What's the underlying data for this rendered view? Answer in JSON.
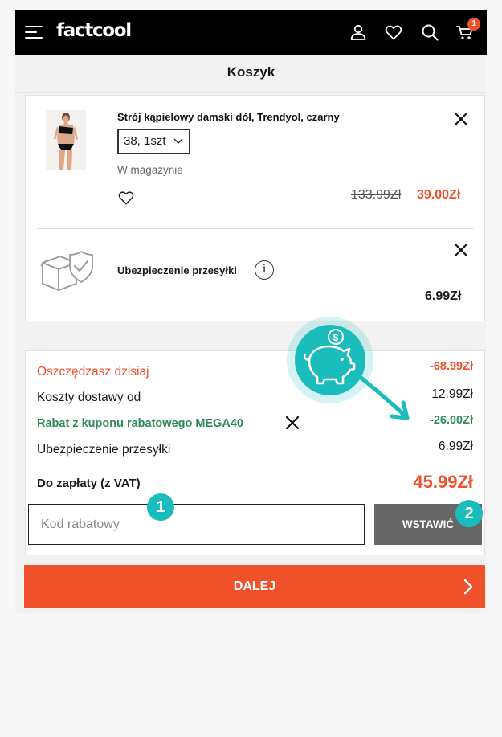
{
  "header": {
    "logo_text": "factcool",
    "cart_count": "1",
    "icons": [
      "menu-icon",
      "account-icon",
      "heart-icon",
      "search-icon",
      "cart-icon"
    ]
  },
  "page_title": "Koszyk",
  "cart_item": {
    "name": "Strój kąpielowy damski dół, Trendyol, czarny",
    "size_qty": "38, 1szt",
    "stock_status": "W magazynie",
    "price_old": "133.99Zł",
    "price_new": "39.00Zł"
  },
  "insurance_item": {
    "name": "Ubezpieczenie przesyłki",
    "info_glyph": "i",
    "price": "6.99Zł"
  },
  "summary": {
    "savings_label": "Oszczędzasz dzisiaj",
    "savings_value": "-68.99Zł",
    "shipping_label": "Koszty dostawy od",
    "shipping_value": "12.99Zł",
    "coupon_label": "Rabat z kuponu rabatowego MEGA40",
    "coupon_value": "-26.00Zł",
    "insurance_label": "Ubezpieczenie przesyłki",
    "insurance_value": "6.99Zł",
    "total_label": "Do zapłaty (z VAT)",
    "total_value": "45.99Zł"
  },
  "coupon_form": {
    "placeholder": "Kod rabatowy",
    "value": "",
    "apply_label": "WSTAWIĆ"
  },
  "next_button_label": "DALEJ",
  "annotations": {
    "step1": "1",
    "step2": "2",
    "piggy_symbol": "$"
  },
  "colors": {
    "accent_orange": "#f0502a",
    "coupon_green": "#2e8b57",
    "annotation_teal": "#1bbcbc",
    "header_black": "#000000",
    "apply_button_gray": "#666666"
  }
}
